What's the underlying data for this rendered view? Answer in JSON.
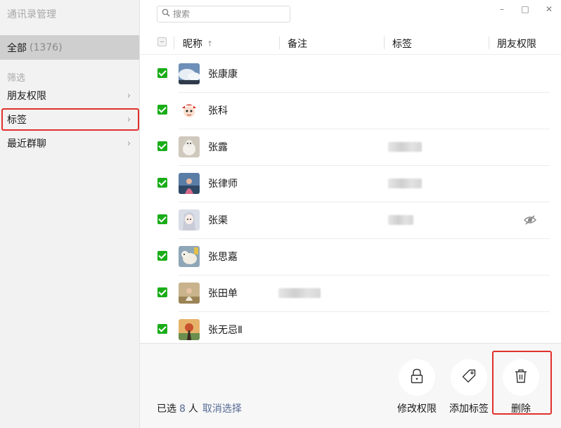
{
  "app": {
    "title": "通讯录管理"
  },
  "sidebar": {
    "all_label": "全部",
    "all_count": "(1376)",
    "filter_heading": "筛选",
    "items": [
      {
        "label": "朋友权限"
      },
      {
        "label": "标签"
      },
      {
        "label": "最近群聊"
      }
    ]
  },
  "search": {
    "placeholder": "搜索"
  },
  "window_controls": {
    "minimize": "–",
    "maximize": "□",
    "close": "✕"
  },
  "table": {
    "columns": [
      {
        "label": "昵称",
        "sort": "↑"
      },
      {
        "label": "备注"
      },
      {
        "label": "标签"
      },
      {
        "label": "朋友权限"
      }
    ],
    "rows": [
      {
        "name": "张康康",
        "checked": true,
        "avatar": "sky-clouds"
      },
      {
        "name": "张科",
        "checked": true,
        "avatar": "red-cap-cartoon"
      },
      {
        "name": "张露",
        "checked": true,
        "avatar": "white-dog"
      },
      {
        "name": "张律师",
        "checked": true,
        "avatar": "girl-lake"
      },
      {
        "name": "张渠",
        "checked": true,
        "avatar": "anime-girl",
        "permission_icon": "hidden-eye-icon"
      },
      {
        "name": "张思嘉",
        "checked": true,
        "avatar": "polar-animal"
      },
      {
        "name": "张田单",
        "checked": true,
        "avatar": "child-field"
      },
      {
        "name": "张无忌Ⅱ",
        "checked": true,
        "avatar": "sunset-figure"
      }
    ]
  },
  "footer": {
    "selected_prefix": "已选",
    "selected_count": "8",
    "selected_unit": "人",
    "cancel_label": "取消选择",
    "actions": [
      {
        "label": "修改权限",
        "icon": "lock-icon"
      },
      {
        "label": "添加标签",
        "icon": "tag-icon"
      },
      {
        "label": "删除",
        "icon": "trash-icon"
      }
    ]
  },
  "colors": {
    "accent_green": "#1aad19",
    "link_blue": "#576b95",
    "highlight_red": "#e0312c"
  }
}
